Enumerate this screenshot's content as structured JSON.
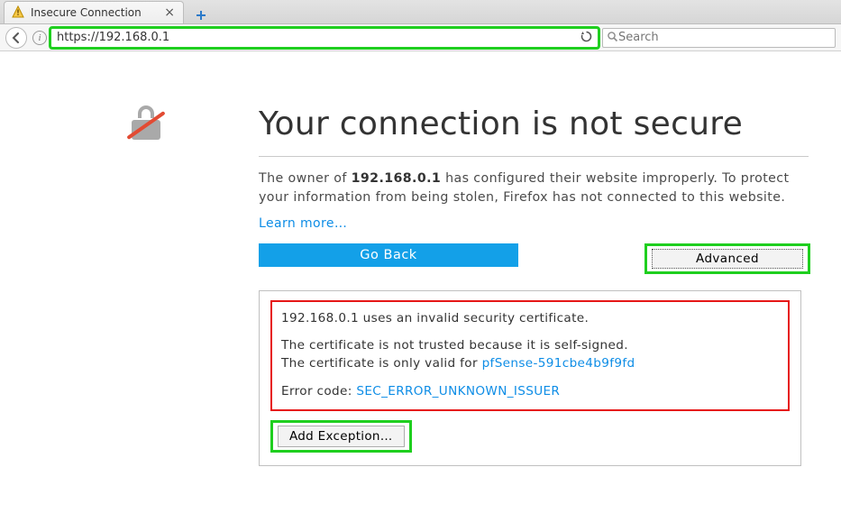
{
  "tab": {
    "title": "Insecure Connection"
  },
  "nav": {
    "url": "https://192.168.0.1",
    "search_placeholder": "Search"
  },
  "err": {
    "heading": "Your connection is not secure",
    "ip": "192.168.0.1",
    "desc_prefix": "The owner of ",
    "desc_suffix": " has configured their website improperly. To protect your information from being stolen, Firefox has not connected to this website.",
    "learn": "Learn more…",
    "go_back": "Go Back",
    "advanced": "Advanced",
    "cert_line1a": " uses an invalid security certificate.",
    "cert_line2": "The certificate is not trusted because it is self-signed.",
    "cert_line3_pre": "The certificate is only valid for ",
    "cert_cn": "pfSense-591cbe4b9f9fd",
    "err_label": "Error code: ",
    "err_code": "SEC_ERROR_UNKNOWN_ISSUER",
    "add_exception": "Add Exception…"
  }
}
